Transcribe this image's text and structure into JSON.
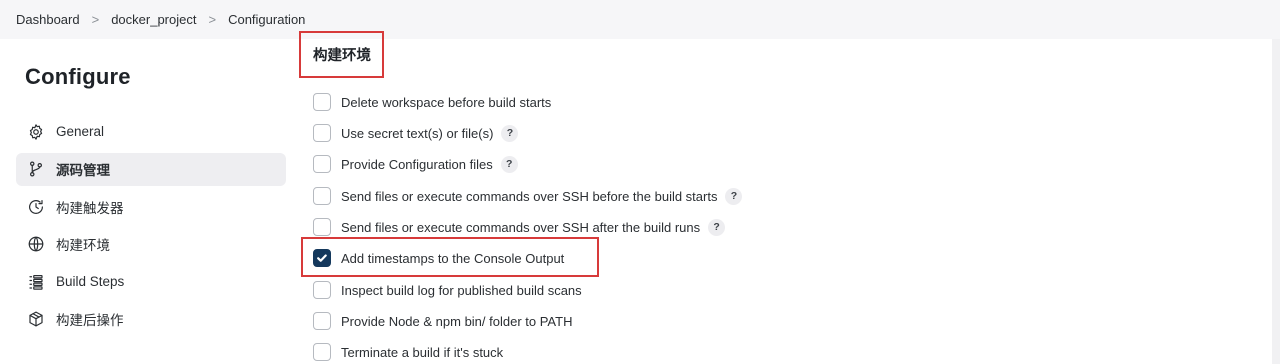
{
  "breadcrumb": {
    "items": [
      "Dashboard",
      "docker_project",
      "Configuration"
    ],
    "separator": ">"
  },
  "page": {
    "title": "Configure"
  },
  "sidebar": {
    "items": [
      {
        "label": "General",
        "icon": "gear-icon"
      },
      {
        "label": "源码管理",
        "icon": "branch-icon",
        "active": true
      },
      {
        "label": "构建触发器",
        "icon": "clock-icon"
      },
      {
        "label": "构建环境",
        "icon": "globe-icon"
      },
      {
        "label": "Build Steps",
        "icon": "list-icon"
      },
      {
        "label": "构建后操作",
        "icon": "box-icon"
      }
    ]
  },
  "section": {
    "title": "构建环境",
    "options": [
      {
        "label": "Delete workspace before build starts",
        "checked": false,
        "help": false
      },
      {
        "label": "Use secret text(s) or file(s)",
        "checked": false,
        "help": true
      },
      {
        "label": "Provide Configuration files",
        "checked": false,
        "help": true
      },
      {
        "label": "Send files or execute commands over SSH before the build starts",
        "checked": false,
        "help": true
      },
      {
        "label": "Send files or execute commands over SSH after the build runs",
        "checked": false,
        "help": true
      },
      {
        "label": "Add timestamps to the Console Output",
        "checked": true,
        "help": false
      },
      {
        "label": "Inspect build log for published build scans",
        "checked": false,
        "help": false
      },
      {
        "label": "Provide Node & npm bin/ folder to PATH",
        "checked": false,
        "help": false
      },
      {
        "label": "Terminate a build if it's stuck",
        "checked": false,
        "help": false
      }
    ],
    "help_glyph": "?"
  },
  "colors": {
    "accent": "#14385c",
    "highlight": "#d73a3a",
    "breadcrumb_bg": "#f6f6f8",
    "active_nav_bg": "#eeeef1"
  }
}
